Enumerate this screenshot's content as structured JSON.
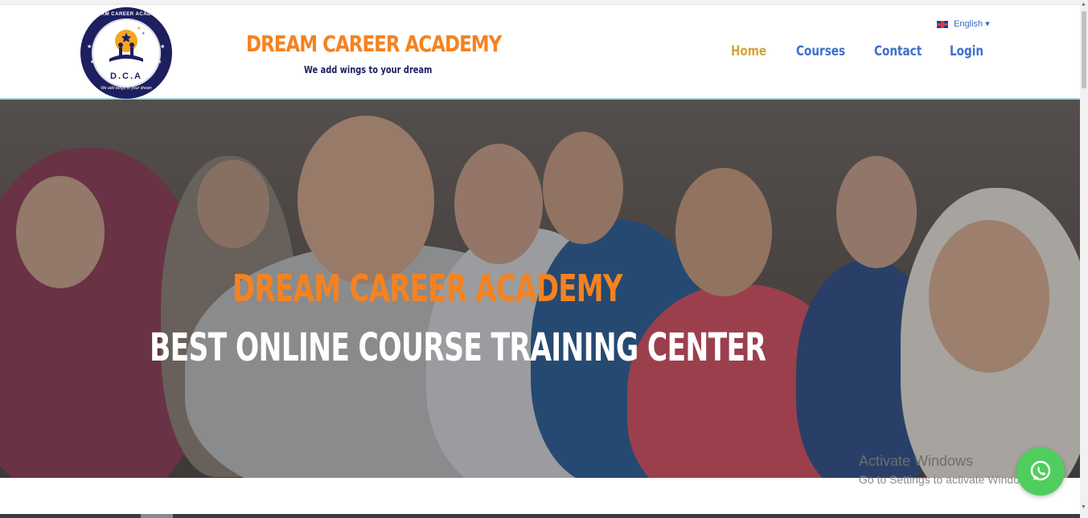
{
  "logo": {
    "ring_text": "DREAM CAREER ACADEMY",
    "center_text": "D.C.A",
    "ring_subtext": "We add wings to your dream"
  },
  "brand": {
    "title": "DREAM CAREER ACADEMY",
    "tagline": "We add wings to your dream"
  },
  "language": {
    "label": "English",
    "caret": "▾",
    "flag_icon": "uk-flag-icon"
  },
  "nav": {
    "items": [
      {
        "label": "Home",
        "active": true
      },
      {
        "label": "Courses",
        "active": false
      },
      {
        "label": "Contact",
        "active": false
      },
      {
        "label": "Login",
        "active": false
      }
    ]
  },
  "hero": {
    "title": "DREAM CAREER ACADEMY",
    "subtitle": "BEST ONLINE COURSE TRAINING CENTER"
  },
  "watermark": {
    "line1": "Activate Windows",
    "line2": "Go to Settings to activate Windows."
  },
  "whatsapp": {
    "icon": "whatsapp-icon"
  },
  "colors": {
    "brand_orange": "#f58220",
    "nav_blue": "#3d6fd0",
    "nav_active": "#d4a338",
    "whatsapp_green": "#4fce5d"
  }
}
